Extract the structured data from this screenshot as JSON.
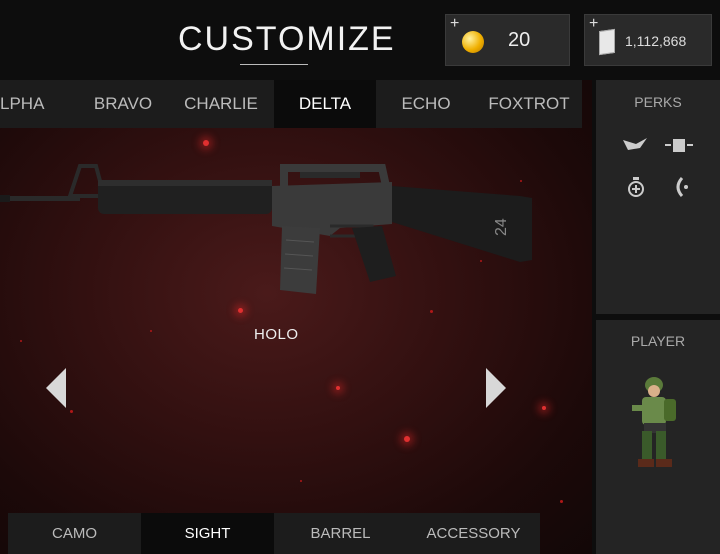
{
  "header": {
    "title": "CUSTOMIZE",
    "coins": {
      "plus": "+",
      "value": "20",
      "icon": "coin-icon"
    },
    "cash": {
      "plus": "+",
      "value": "1,112,868",
      "icon": "cash-icon"
    }
  },
  "tabs": [
    {
      "label": "LPHA",
      "active": false
    },
    {
      "label": "BRAVO",
      "active": false
    },
    {
      "label": "CHARLIE",
      "active": false
    },
    {
      "label": "DELTA",
      "active": true
    },
    {
      "label": "ECHO",
      "active": false
    },
    {
      "label": "FOXTROT",
      "active": false
    }
  ],
  "weapon": {
    "sight_label": "HOLO",
    "stock_marking": "24"
  },
  "perks": {
    "title": "PERKS"
  },
  "player": {
    "title": "PLAYER"
  },
  "bottom_tabs": [
    {
      "label": "CAMO",
      "active": false
    },
    {
      "label": "SIGHT",
      "active": true
    },
    {
      "label": "BARREL",
      "active": false
    },
    {
      "label": "ACCESSORY",
      "active": false
    }
  ],
  "colors": {
    "background_red": "#321010",
    "tab_bar": "#1c1c1c",
    "tab_active": "#0b0b0b",
    "coin_gold": "#f0b000"
  }
}
